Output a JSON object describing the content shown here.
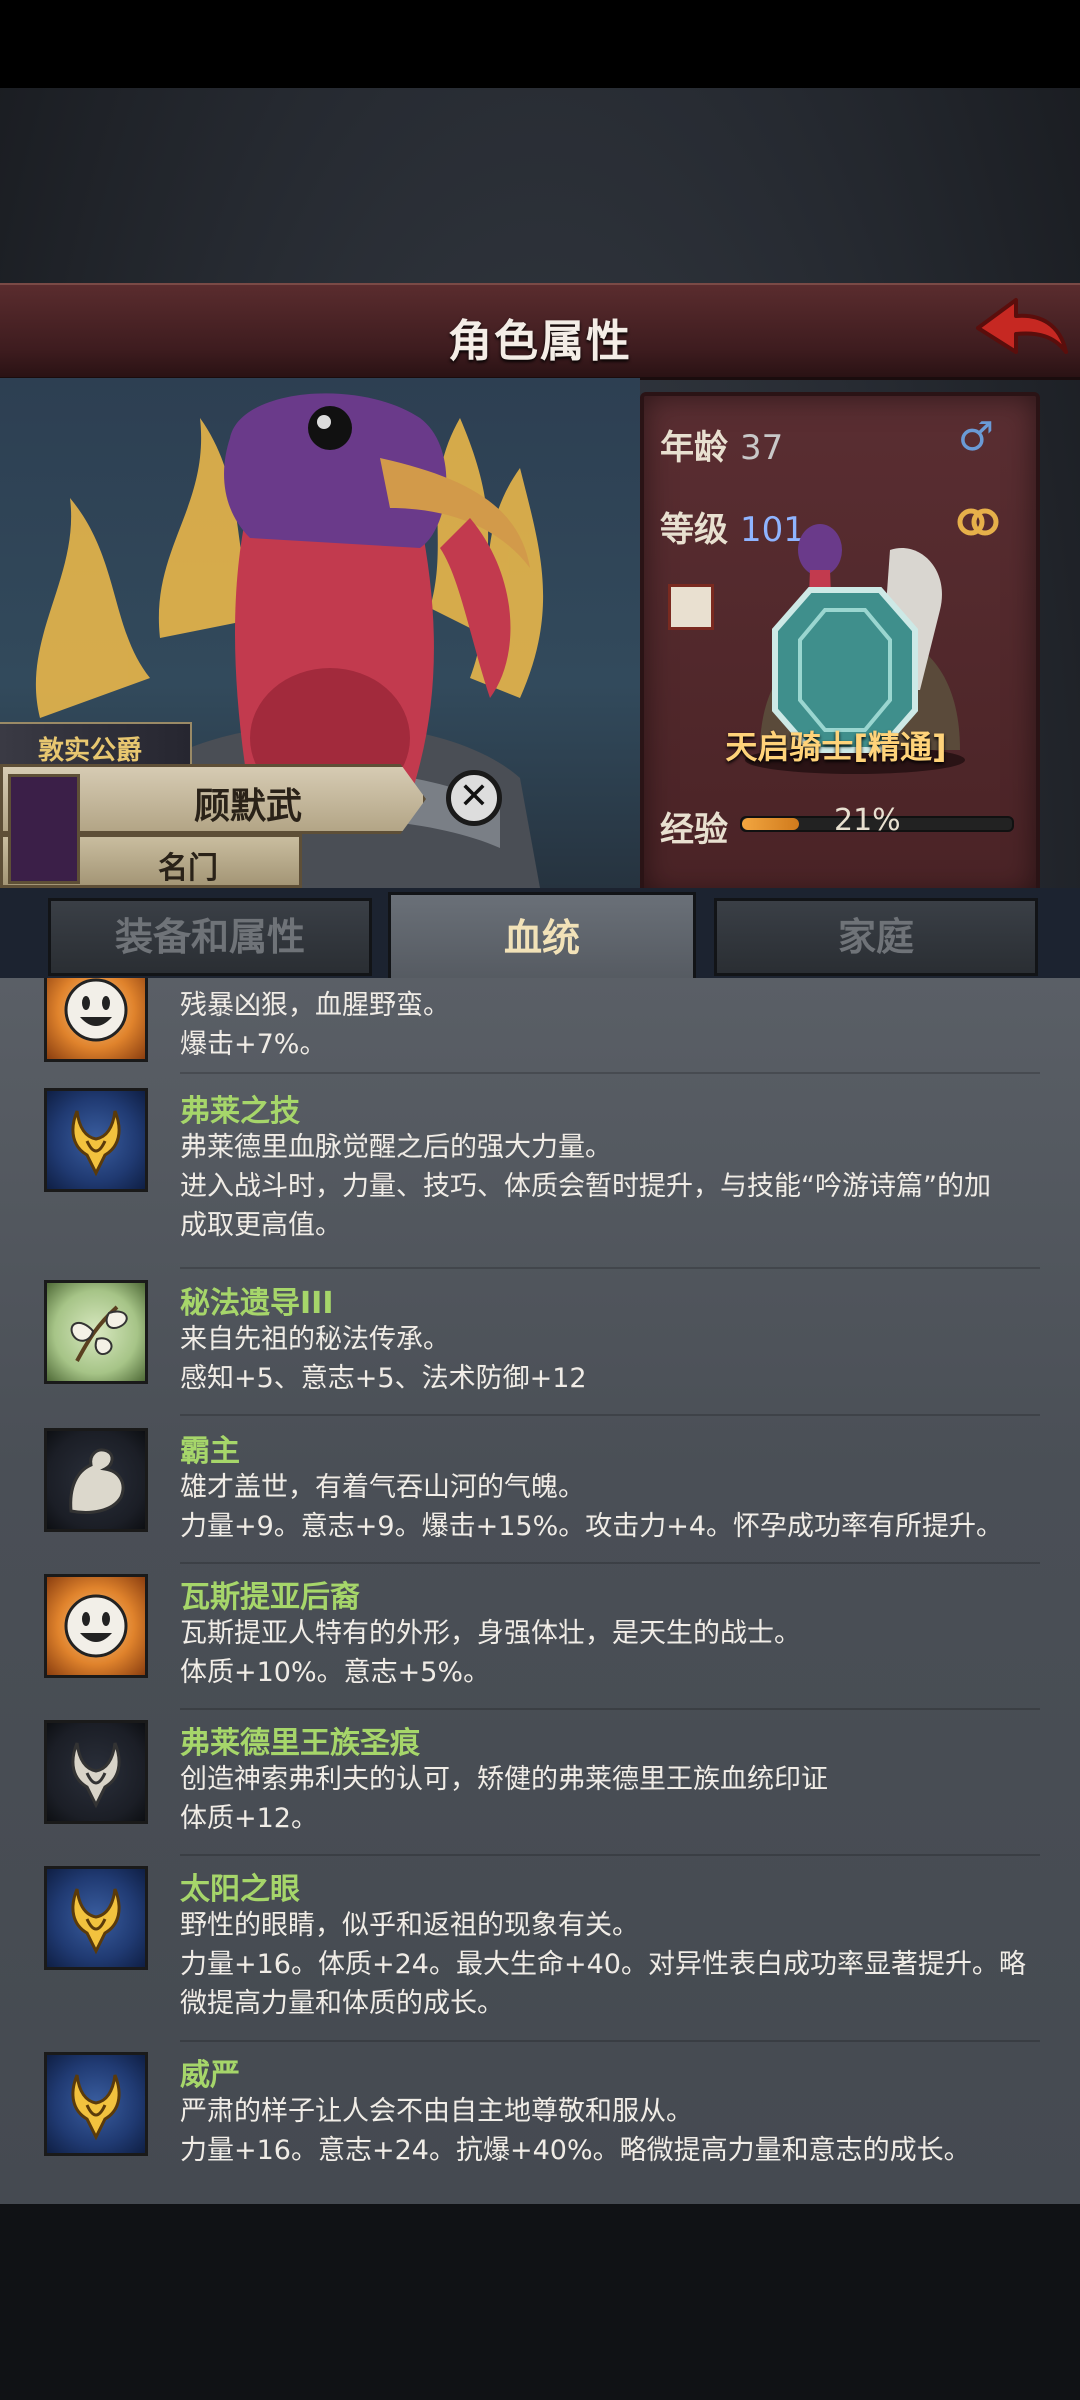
{
  "header": {
    "title": "角色属性"
  },
  "hero": {
    "noble_title": "敦实公爵",
    "name": "顾默武",
    "clan": "名门"
  },
  "info": {
    "age_label": "年龄",
    "age": "37",
    "gender_symbol": "♂",
    "level_label": "等级",
    "level": "101",
    "class_name": "天启骑士[精通]",
    "exp_label": "经验",
    "exp_percent": "21%",
    "exp_fraction": 0.21
  },
  "tabs": [
    {
      "label": "装备和属性",
      "active": false
    },
    {
      "label": "血统",
      "active": true
    },
    {
      "label": "家庭",
      "active": false
    }
  ],
  "bloodlines": [
    {
      "name": "",
      "icon": "smiling-sun-icon",
      "desc": [
        "残暴凶狠，血腥野蛮。",
        "爆击+7%。"
      ]
    },
    {
      "name": "弗莱之技",
      "icon": "golden-crown-icon",
      "desc": [
        "弗莱德里血脉觉醒之后的强大力量。",
        "进入战斗时，力量、技巧、体质会暂时提升，与技能“吟游诗篇”的加",
        "成取更高值。"
      ]
    },
    {
      "name": "秘法遗导III",
      "icon": "leaf-branch-icon",
      "desc": [
        "来自先祖的秘法传承。",
        "感知+5、意志+5、法术防御+12"
      ]
    },
    {
      "name": "霸主",
      "icon": "flexed-arm-icon",
      "desc": [
        "雄才盖世，有着气吞山河的气魄。",
        "力量+9。意志+9。爆击+15%。攻击力+4。怀孕成功率有所提升。"
      ]
    },
    {
      "name": "瓦斯提亚后裔",
      "icon": "smiling-sun-icon",
      "desc": [
        "瓦斯提亚人特有的外形，身强体壮，是天生的战士。",
        "体质+10%。意志+5%。"
      ]
    },
    {
      "name": "弗莱德里王族圣痕",
      "icon": "silver-crown-icon",
      "desc": [
        "创造神索弗利夫的认可，矫健的弗莱德里王族血统印证",
        "体质+12。"
      ]
    },
    {
      "name": "太阳之眼",
      "icon": "golden-crown-icon",
      "desc": [
        "野性的眼睛，似乎和返祖的现象有关。",
        "力量+16。体质+24。最大生命+40。对异性表白成功率显著提升。略",
        "微提高力量和体质的成长。"
      ]
    },
    {
      "name": "威严",
      "icon": "golden-crown-icon",
      "desc": [
        "严肃的样子让人会不由自主地尊敬和服从。",
        "力量+16。意志+24。抗爆+40%。略微提高力量和意志的成长。"
      ]
    }
  ]
}
